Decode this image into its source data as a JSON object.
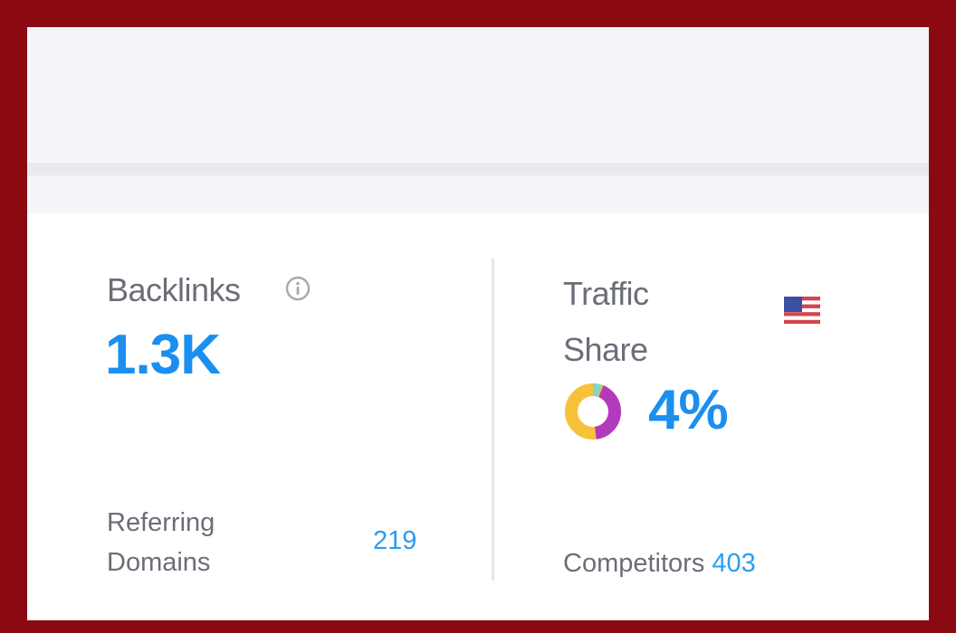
{
  "backlinks": {
    "label": "Backlinks",
    "info_icon": "info-circle-icon",
    "value": "1.3K",
    "referring_domains_label": "Referring Domains",
    "referring_domains_value": "219"
  },
  "traffic_share": {
    "label": "Traffic Share",
    "flag_icon": "us-flag-icon",
    "donut_share_percent": 4,
    "value": "4%",
    "competitors_label": "Competitors",
    "competitors_value": "403"
  },
  "colors": {
    "frame": "#8b0a12",
    "accent_blue": "#1b8fef",
    "donut_main": "#f8c13a",
    "donut_share": "#b23bbd",
    "donut_small": "#7fd4c9"
  }
}
